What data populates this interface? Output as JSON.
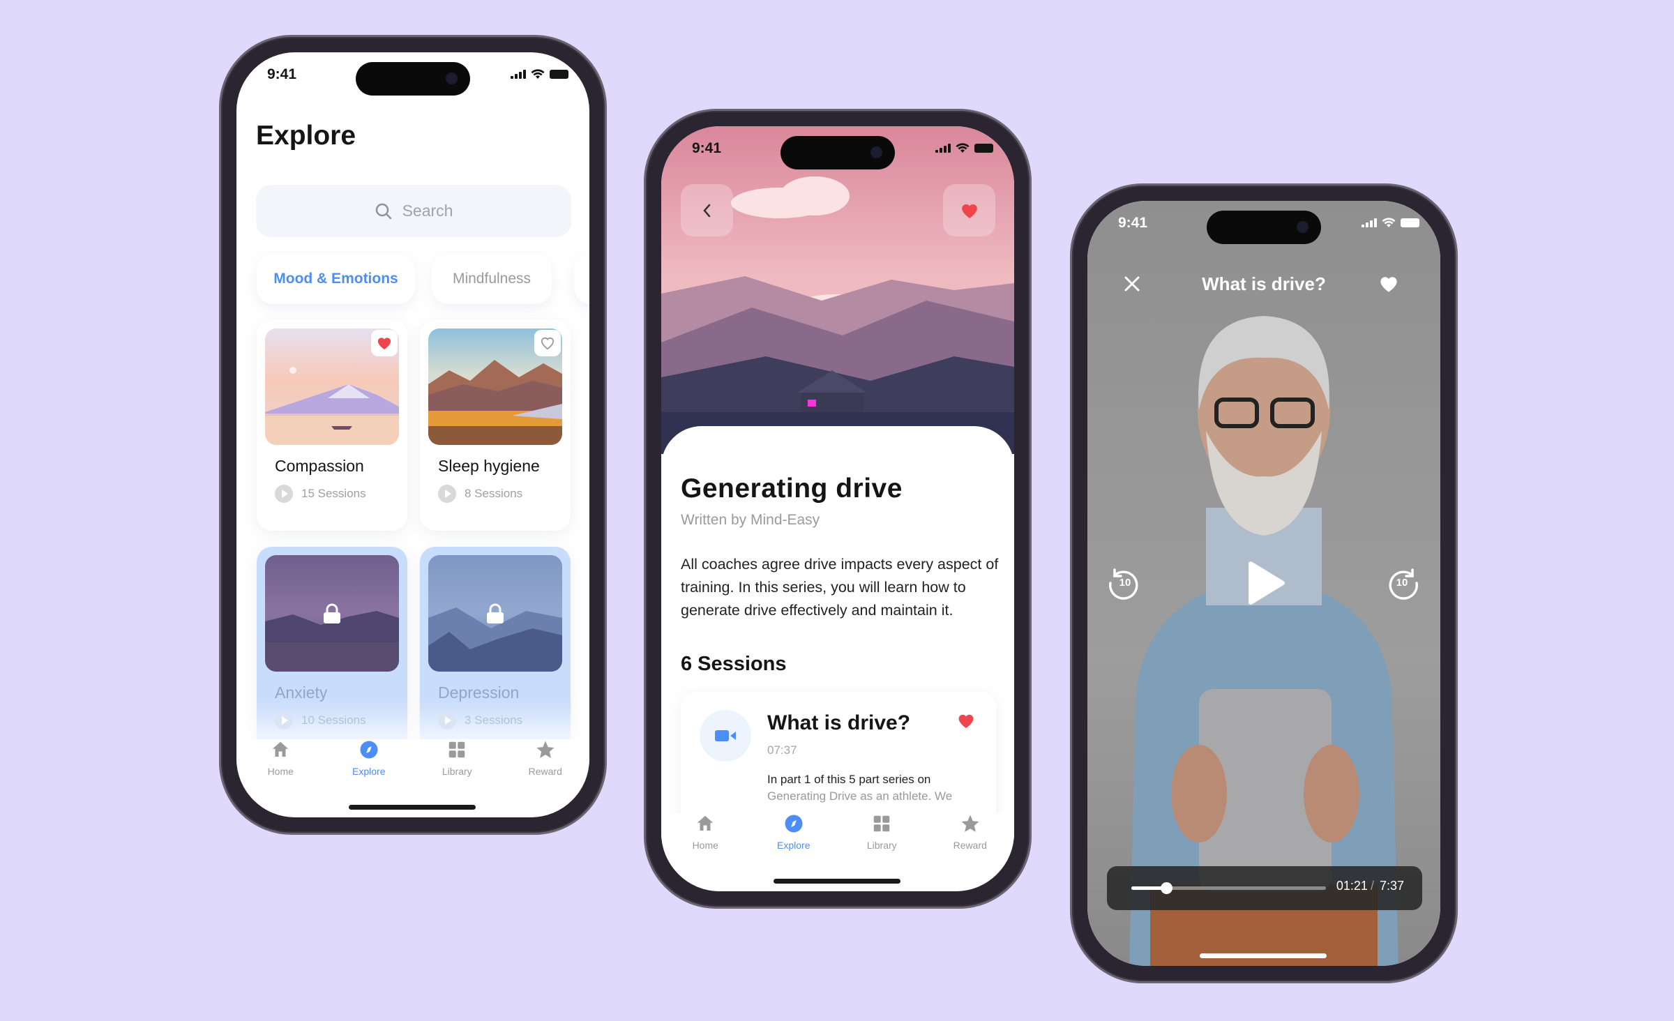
{
  "colors": {
    "background": "#dfd9fb",
    "accent": "#4c8df6",
    "heart": "#f0444c"
  },
  "status_time": "9:41",
  "tabbar": {
    "items": [
      {
        "label": "Home",
        "icon": "home-icon"
      },
      {
        "label": "Explore",
        "icon": "compass-icon",
        "active": true
      },
      {
        "label": "Library",
        "icon": "grid-icon"
      },
      {
        "label": "Reward",
        "icon": "star-icon"
      }
    ]
  },
  "explore": {
    "title": "Explore",
    "search_placeholder": "Search",
    "categories": [
      {
        "label": "Mood & Emotions",
        "active": true
      },
      {
        "label": "Mindfulness"
      }
    ],
    "cards": [
      {
        "title": "Compassion",
        "sessions": "15 Sessions",
        "favorited": true,
        "locked": false
      },
      {
        "title": "Sleep hygiene",
        "sessions": "8 Sessions",
        "favorited": false,
        "locked": false
      },
      {
        "title": "Anxiety",
        "sessions": "10 Sessions",
        "locked": true
      },
      {
        "title": "Depression",
        "sessions": "3 Sessions",
        "locked": true
      }
    ]
  },
  "detail": {
    "title": "Generating drive",
    "byline": "Written by Mind-Easy",
    "description": "All coaches agree drive impacts every aspect of training. In this series, you will learn how to generate drive effectively and maintain it.",
    "sessions_heading": "6 Sessions",
    "session": {
      "title": "What is drive?",
      "duration": "07:37",
      "desc_line1": "In part 1 of this 5 part series on",
      "desc_line2": "Generating Drive as an athlete. We",
      "favorited": true
    }
  },
  "player": {
    "title": "What is drive?",
    "current": "01:21",
    "separator": "/",
    "total": "7:37",
    "progress": 0.18,
    "skip_back": "10",
    "skip_forward": "10"
  }
}
